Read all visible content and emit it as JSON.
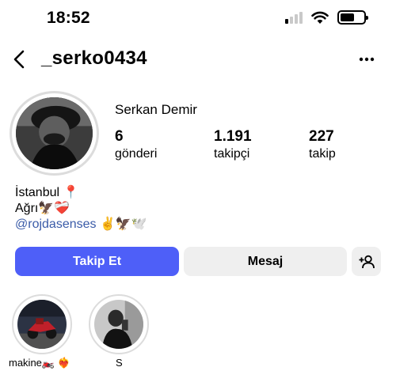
{
  "status_bar": {
    "time": "18:52"
  },
  "header": {
    "username": "_serko0434"
  },
  "profile": {
    "display_name": "Serkan Demir",
    "stats": [
      {
        "value": "6",
        "label": "gönderi"
      },
      {
        "value": "1.191",
        "label": "takipçi"
      },
      {
        "value": "227",
        "label": "takip"
      }
    ],
    "bio": {
      "line1": "İstanbul 📍",
      "line2": "Ağrı🦅❤️‍🩹",
      "link": "@rojdasenses",
      "link_suffix": " ✌️🦅🕊️"
    }
  },
  "actions": {
    "follow_label": "Takip Et",
    "message_label": "Mesaj"
  },
  "highlights": [
    {
      "label": "makine🏍️ ❤️‍🔥"
    },
    {
      "label": "S"
    }
  ],
  "colors": {
    "follow_button": "#4e5ff8",
    "secondary_button": "#efefef",
    "link": "#3a5ba8"
  }
}
